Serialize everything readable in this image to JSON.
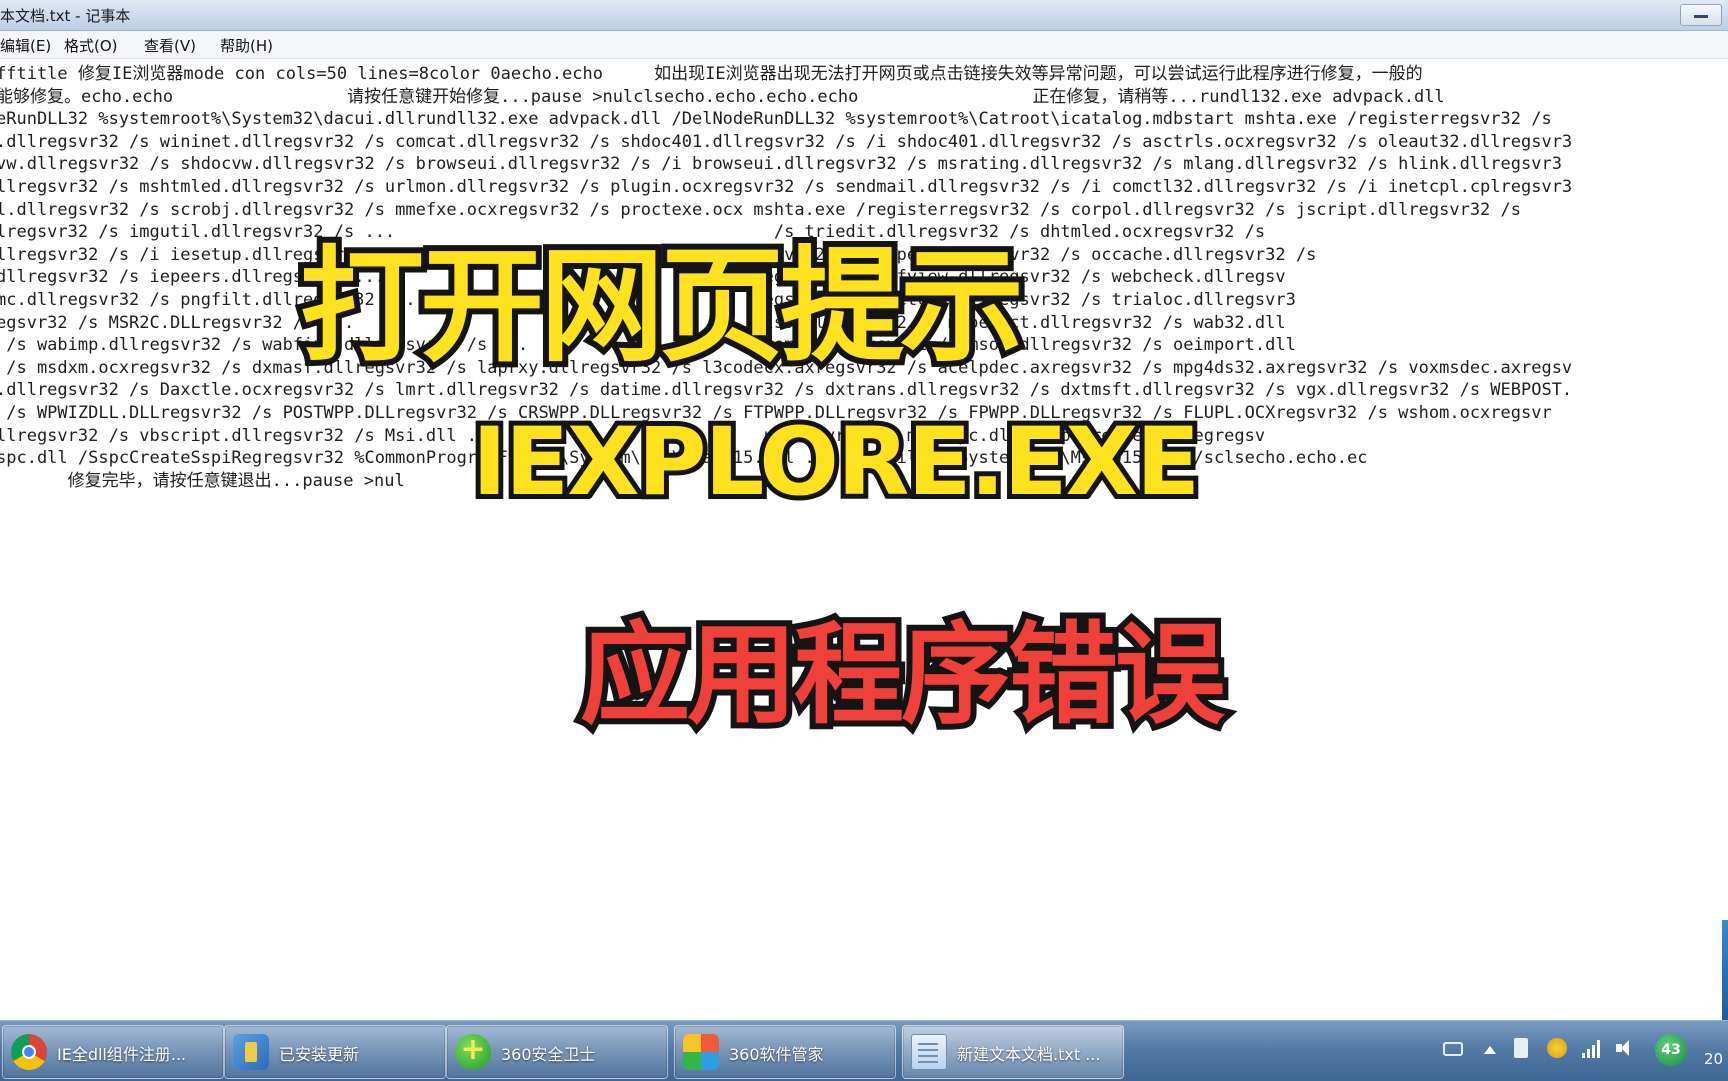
{
  "window": {
    "title": "本文档.txt - 记事本"
  },
  "menubar": {
    "items": [
      "编辑(E)",
      "格式(O)",
      "查看(V)",
      "帮助(H)"
    ]
  },
  "editor": {
    "lines": [
      "fftitle 修复IE浏览器mode con cols=50 lines=8color 0aecho.echo     如出现IE浏览器出现无法打开网页或点击链接失效等异常问题，可以尝试运行此程序进行修复，一般的",
      "能够修复。echo.echo                 请按任意键开始修复...pause >nulclsecho.echo.echo.echo                 正在修复，请稍等...rundl132.exe advpack.dll",
      "eRunDLL32 %systemroot%\\System32\\dacui.dllrundll32.exe advpack.dll /DelNodeRunDLL32 %systemroot%\\Catroot\\icatalog.mdbstart mshta.exe /registerregsvr32 /s",
      ".dllregsvr32 /s wininet.dllregsvr32 /s comcat.dllregsvr32 /s shdoc401.dllregsvr32 /s /i shdoc401.dllregsvr32 /s asctrls.ocxregsvr32 /s oleaut32.dllregsvr3",
      "vw.dllregsvr32 /s shdocvw.dllregsvr32 /s browseui.dllregsvr32 /s /i browseui.dllregsvr32 /s msrating.dllregsvr32 /s mlang.dllregsvr32 /s hlink.dllregsvr3",
      "llregsvr32 /s mshtmled.dllregsvr32 /s urlmon.dllregsvr32 /s plugin.ocxregsvr32 /s sendmail.dllregsvr32 /s /i comctl32.dllregsvr32 /s /i inetcpl.cplregsvr3",
      "l.dllregsvr32 /s scrobj.dllregsvr32 /s mmefxe.ocxregsvr32 /s proctexe.ocx mshta.exe /registerregsvr32 /s corpol.dllregsvr32 /s jscript.dllregsvr32 /s",
      "lregsvr32 /s imgutil.dllregsvr32 /s ...                                     /s triedit.dllregsvr32 /s dhtmled.ocxregsvr32 /s",
      "llregsvr32 /s /i iesetup.dllregsvr32 ...                                   gsvr32 /s dispex.dllregsvr32 /s occache.dllregsvr32 /s",
      "dllregsvr32 /s iepeers.dllregsvr32 ...                                    regsvr32 /s cdfview.dllregsvr32 /s webcheck.dllregsv",
      "mc.dllregsvr32 /s pngfilt.dllregsvr32 ...                                 regsvr32 /s inetcfg.dllregsvr32 /s trialoc.dllregsvr3",
      "egsvr32 /s MSR2C.DLLregsvr32 /s ...                                       ils.dllregsvr32 /s msoeacct.dllregsvr32 /s wab32.dll",
      " /s wabimp.dllregsvr32 /s wabfind.dllregsvr32 /s ...                      lcomm.dllregsvr32 /s msoe.dllregsvr32 /s oeimport.dll",
      " /s msdxm.ocxregsvr32 /s dxmasf.dllregsvr32 /s laprxy.dllregsvr32 /s l3codecx.axregsvr32 /s acelpdec.axregsvr32 /s mpg4ds32.axregsvr32 /s voxmsdec.axregsv",
      ".dllregsvr32 /s Daxctle.ocxregsvr32 /s lmrt.dllregsvr32 /s datime.dllregsvr32 /s dxtrans.dllregsvr32 /s dxtmsft.dllregsvr32 /s vgx.dllregsvr32 /s WEBPOST.",
      " /s WPWIZDLL.DLLregsvr32 /s POSTWPP.DLLregsvr32 /s CRSWPP.DLLregsvr32 /s FTPWPP.DLLregsvr32 /s FPWPP.DLLregsvr32 /s FLUPL.OCXregsvr32 /s wshom.ocxregsvr",
      "llregsvr32 /s vbscript.dllregsvr32 /s Msi.dll ...                          upregsvr32 /s msnsspc.dll /SspcCreateSspiRegregsv",
      "spc.dll /SspcCreateSspiRegregsvr32 %CommonProgramFiles%\\System\\ado\\Msado15.dll ...   amFiles%\\System\\ado\\Msado15.dll /sclsecho.echo.ec",
      "       修复完毕，请按任意键退出...pause >nul"
    ]
  },
  "overlay": {
    "headline": "打开网页提示",
    "exe": "IEXPLORE.EXE",
    "error": "应用程序错误"
  },
  "taskbar": {
    "tasks": [
      {
        "label": "IE全dll组件注册...",
        "icon": "chrome-icon"
      },
      {
        "label": "已安装更新",
        "icon": "windows-update-icon"
      },
      {
        "label": "360安全卫士",
        "icon": "360-safe-icon"
      },
      {
        "label": "360软件管家",
        "icon": "360-software-icon"
      },
      {
        "label": "新建文本文档.txt ...",
        "icon": "notepad-icon"
      }
    ],
    "tray_badge": "43",
    "clock_partial": "20"
  },
  "colors": {
    "headline_yellow": "#ffe21f",
    "error_red": "#f0403a",
    "outline": "#141414",
    "taskbar_blue": "#547aa6"
  }
}
